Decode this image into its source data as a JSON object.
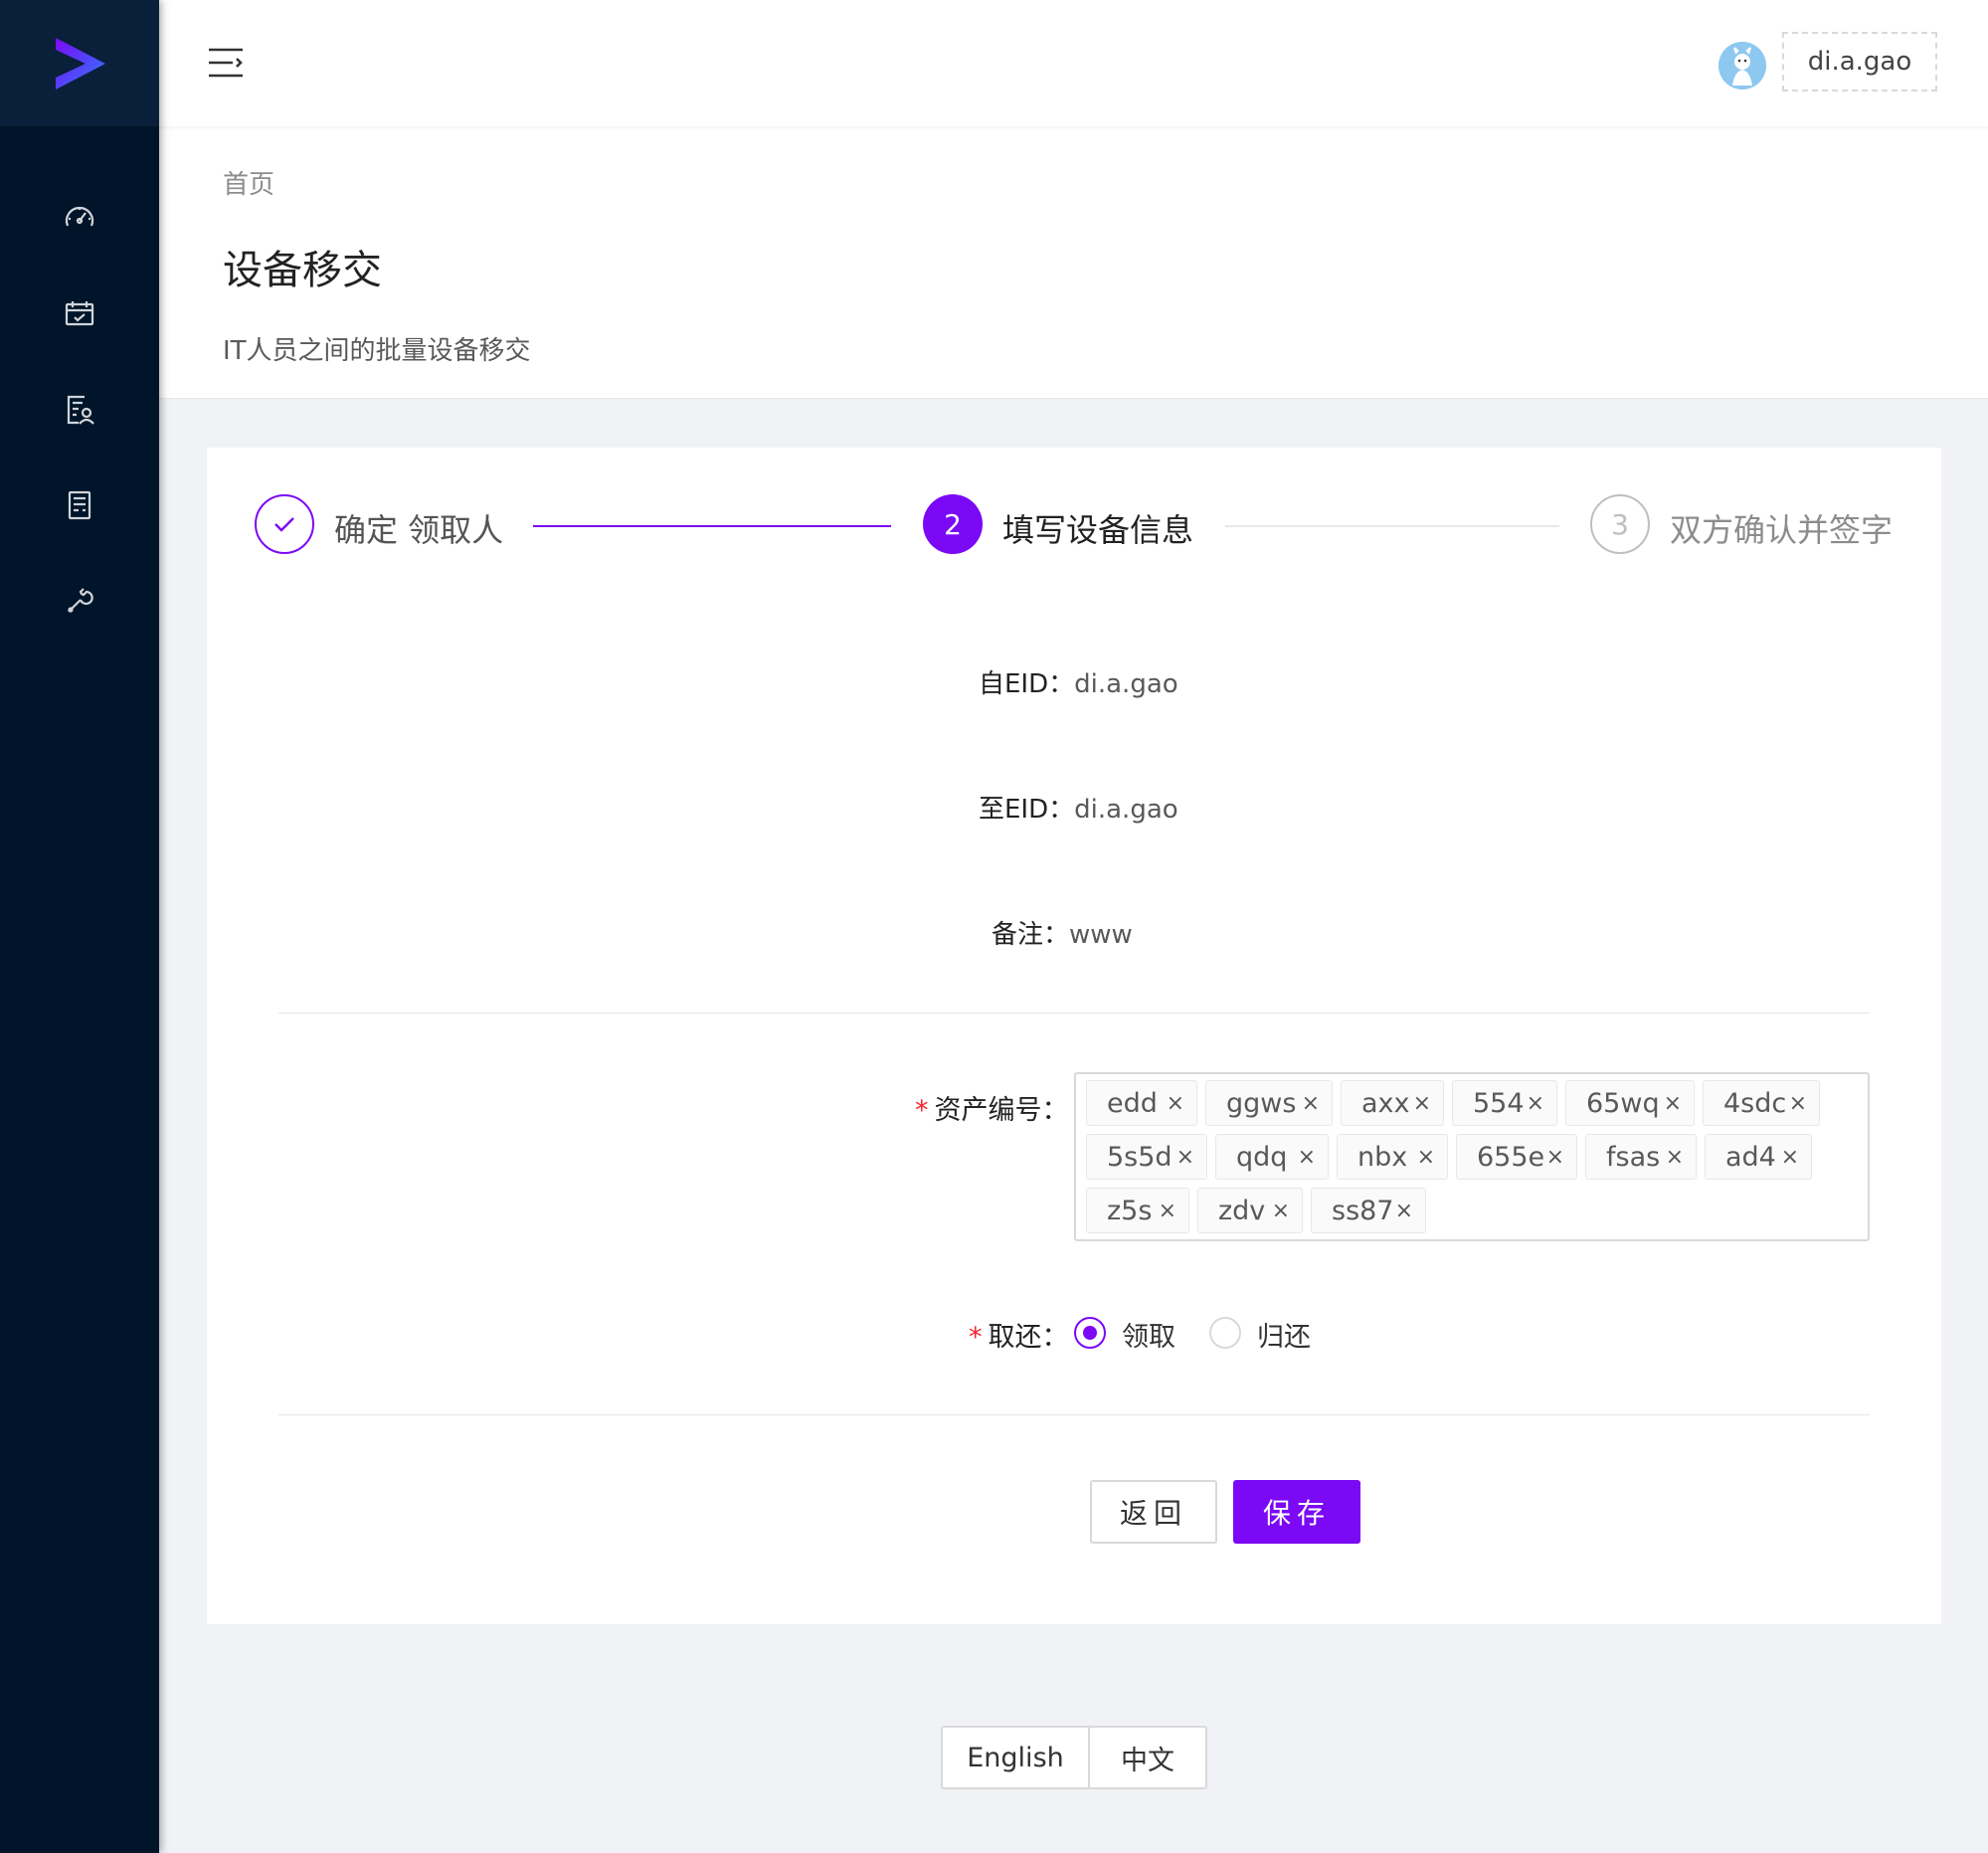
{
  "header": {
    "user_name": "di.a.gao"
  },
  "sidebar": {
    "items": [
      {
        "icon": "dashboard-icon"
      },
      {
        "icon": "calendar-check-icon"
      },
      {
        "icon": "user-document-icon"
      },
      {
        "icon": "form-document-icon"
      },
      {
        "icon": "wrench-icon"
      }
    ]
  },
  "page": {
    "breadcrumb": "首页",
    "title": "设备移交",
    "description": "IT人员之间的批量设备移交"
  },
  "steps": [
    {
      "number": "",
      "title": "确定 领取人",
      "status": "finished"
    },
    {
      "number": "2",
      "title": "填写设备信息",
      "status": "current"
    },
    {
      "number": "3",
      "title": "双方确认并签字",
      "status": "waiting"
    }
  ],
  "info": {
    "from_label": "自EID：",
    "from_value": "di.a.gao",
    "to_label": "至EID：",
    "to_value": "di.a.gao",
    "note_label": "备注：",
    "note_value": "www"
  },
  "form": {
    "asset_label": "资产编号：",
    "required_mark": "*",
    "assets": [
      "edd",
      "ggws",
      "axx",
      "554",
      "65wq",
      "4sdc",
      "5s5d",
      "qdq",
      "nbx",
      "655e",
      "fsas",
      "ad4",
      "z5s",
      "zdv",
      "ss87"
    ],
    "close_glyph": "×",
    "action_label": "取还：",
    "options": [
      "领取",
      "归还"
    ],
    "selected_option": "领取"
  },
  "buttons": {
    "back": "返回",
    "save": "保存"
  },
  "footer": {
    "lang_en": "English",
    "lang_zh": "中文"
  },
  "colors": {
    "primary": "#7b09f5",
    "sidebar": "#001529"
  }
}
